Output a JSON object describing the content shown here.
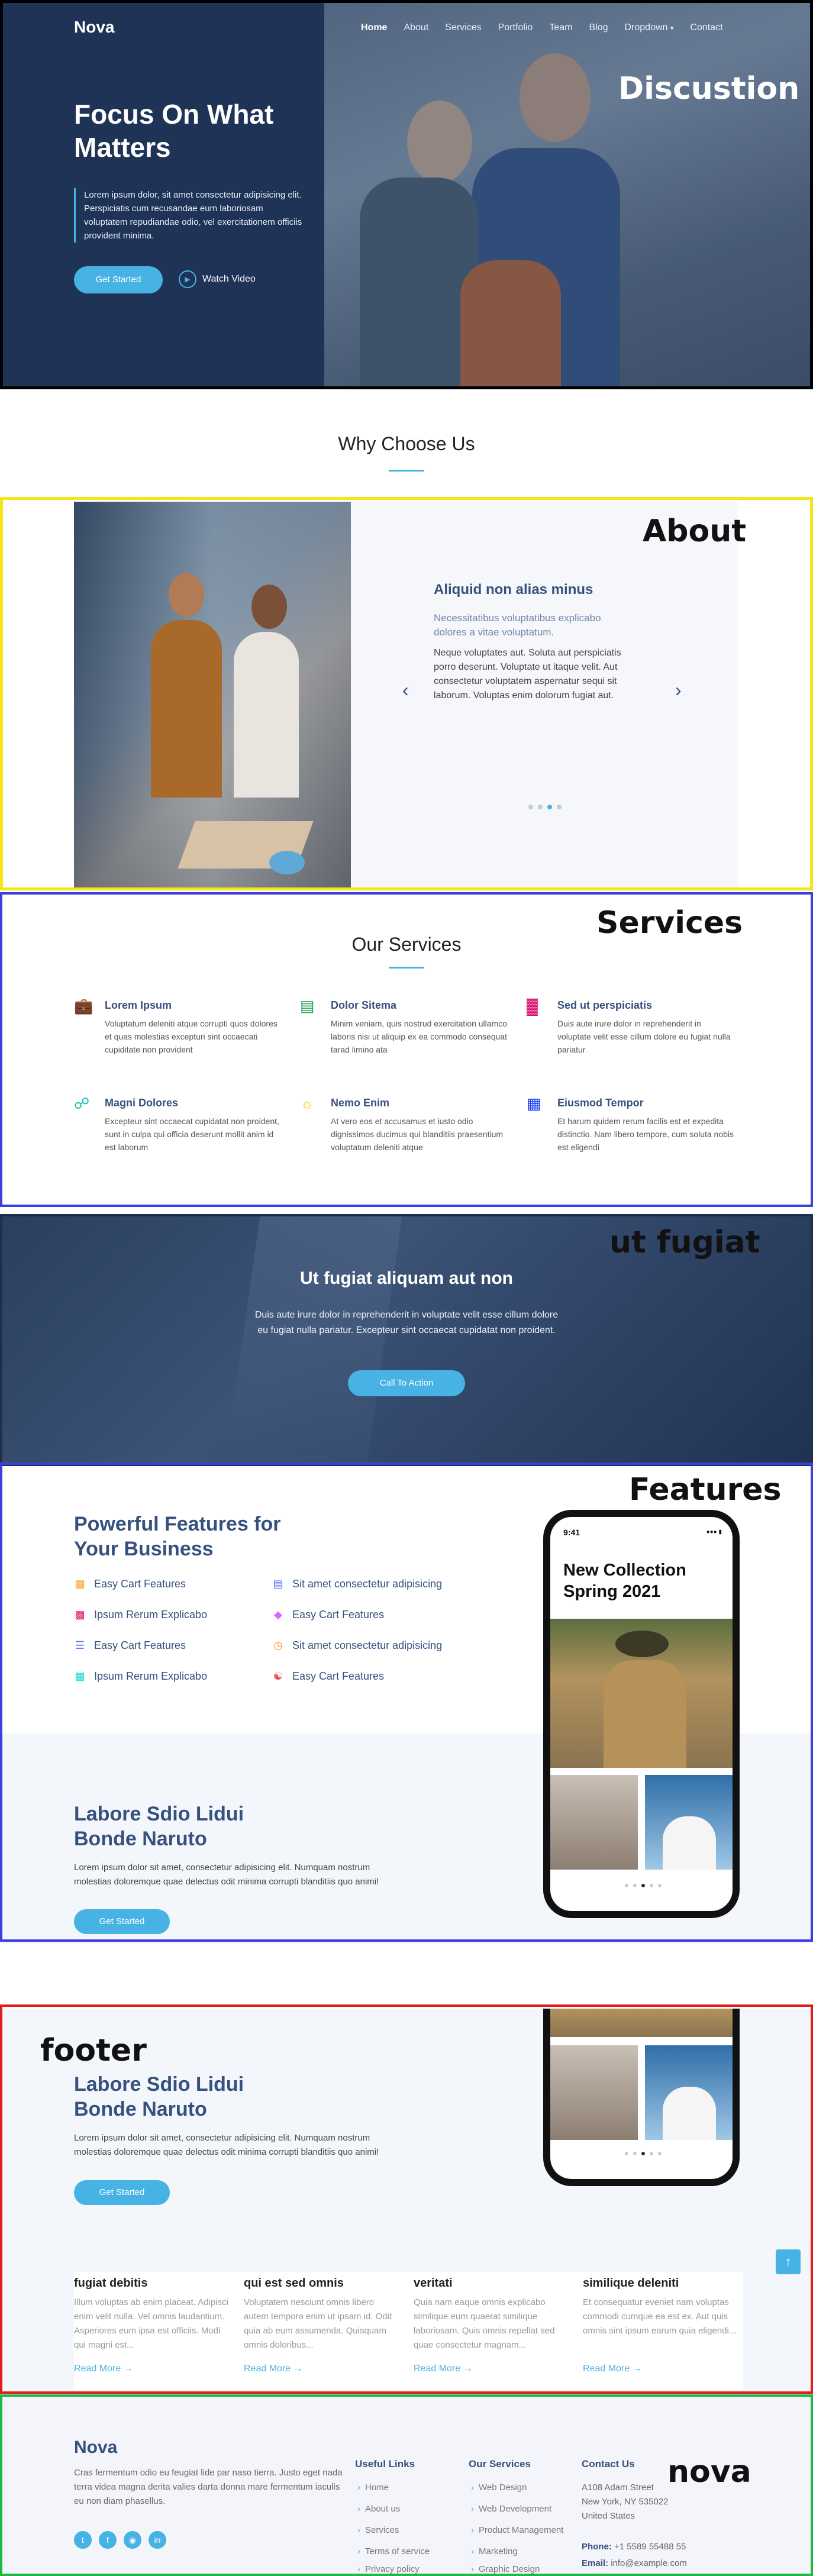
{
  "colors": {
    "accent": "#47b2e4",
    "navy": "#37517e",
    "hero_bg": "#1e3356"
  },
  "nav": {
    "logo": "Nova",
    "items": [
      "Home",
      "About",
      "Services",
      "Portfolio",
      "Team",
      "Blog",
      "Dropdown",
      "Contact"
    ]
  },
  "hero": {
    "title": "Focus On What Matters",
    "lead": "Lorem ipsum dolor, sit amet consectetur adipisicing elit. Perspiciatis cum recusandae eum laboriosam voluptatem repudiandae odio, vel exercitationem officiis provident minima.",
    "get_started": "Get Started",
    "watch_video": "Watch Video",
    "annotation": "Discustion"
  },
  "why": {
    "title": "Why Choose Us"
  },
  "about": {
    "annotation": "About",
    "heading": "Aliquid non alias minus",
    "subheading": "Necessitatibus voluptatibus explicabo dolores a vitae voluptatum.",
    "text": "Neque voluptates aut. Soluta aut perspiciatis porro deserunt. Voluptate ut itaque velit. Aut consectetur voluptatem aspernatur sequi sit laborum. Voluptas enim dolorum fugiat aut."
  },
  "services": {
    "annotation": "Services",
    "title": "Our Services",
    "items": [
      {
        "icon": "briefcase-icon",
        "title": "Lorem Ipsum",
        "text": "Voluptatum deleniti atque corrupti quos dolores et quas molestias excepturi sint occaecati cupiditate non provident"
      },
      {
        "icon": "card-checklist-icon",
        "title": "Dolor Sitema",
        "text": "Minim veniam, quis nostrud exercitation ullamco laboris nisi ut aliquip ex ea commodo consequat tarad limino ata"
      },
      {
        "icon": "bar-chart-icon",
        "title": "Sed ut perspiciatis",
        "text": "Duis aute irure dolor in reprehenderit in voluptate velit esse cillum dolore eu fugiat nulla pariatur"
      },
      {
        "icon": "binoculars-icon",
        "title": "Magni Dolores",
        "text": "Excepteur sint occaecat cupidatat non proident, sunt in culpa qui officia deserunt mollit anim id est laborum"
      },
      {
        "icon": "brightness-icon",
        "title": "Nemo Enim",
        "text": "At vero eos et accusamus et iusto odio dignissimos ducimus qui blanditiis praesentium voluptatum deleniti atque"
      },
      {
        "icon": "calendar-icon",
        "title": "Eiusmod Tempor",
        "text": "Et harum quidem rerum facilis est et expedita distinctio. Nam libero tempore, cum soluta nobis est eligendi"
      }
    ]
  },
  "cta": {
    "annotation": "ut fugiat",
    "title": "Ut fugiat aliquam aut non",
    "text": "Duis aute irure dolor in reprehenderit in voluptate velit esse cillum dolore eu fugiat nulla pariatur. Excepteur sint occaecat cupidatat non proident.",
    "button": "Call To Action"
  },
  "features": {
    "annotation": "Features",
    "title": "Powerful Features for Your Business",
    "items": [
      {
        "icon": "bag-icon",
        "label": "Easy Cart Features",
        "color": "#f5a623"
      },
      {
        "icon": "card-icon",
        "label": "Sit amet consectetur adipisicing",
        "color": "#5578ff"
      },
      {
        "icon": "tags-icon",
        "label": "Ipsum Rerum Explicabo",
        "color": "#e80368"
      },
      {
        "icon": "tags-icon",
        "label": "Easy Cart Features",
        "color": "#e361ff"
      },
      {
        "icon": "stack-icon",
        "label": "Easy Cart Features",
        "color": "#5578ff"
      },
      {
        "icon": "clock-icon",
        "label": "Sit amet consectetur adipisicing",
        "color": "#f58b1e"
      },
      {
        "icon": "list-icon",
        "label": "Ipsum Rerum Explicabo",
        "color": "#11dbcf"
      },
      {
        "icon": "people-icon",
        "label": "Easy Cart Features",
        "color": "#e84d4d"
      }
    ],
    "block_title": "Labore Sdio Lidui Bonde Naruto",
    "block_text": "Lorem ipsum dolor sit amet, consectetur adipisicing elit. Numquam nostrum molestias doloremque quae delectus odit minima corrupti blanditiis quo animi!",
    "block_button": "Get Started",
    "phone_time": "9:41",
    "phone_title": "New Collection Spring 2021"
  },
  "footer_section": {
    "annotation": "footer",
    "block_title": "Labore Sdio Lidui Bonde Naruto",
    "block_text": "Lorem ipsum dolor sit amet, consectetur adipisicing elit. Numquam nostrum molestias doloremque quae delectus odit minima corrupti blanditiis quo animi!",
    "block_button": "Get Started",
    "cards": [
      {
        "title": "fugiat debitis",
        "text": "Illum voluptas ab enim placeat. Adipisci enim velit nulla. Vel omnis laudantium. Asperiores eum ipsa est officiis. Modi qui magni est...",
        "link": "Read More"
      },
      {
        "title": "qui est sed omnis",
        "text": "Voluptatem nesciunt omnis libero autem tempora enim ut ipsam id. Odit quia ab eum assumenda. Quisquam omnis doloribus...",
        "link": "Read More"
      },
      {
        "title": "veritati",
        "text": "Quia nam eaque omnis explicabo similique eum quaerat similique laboriosam. Quis omnis repellat sed quae consectetur magnam...",
        "link": "Read More"
      },
      {
        "title": "similique deleniti",
        "text": "Et consequatur eveniet nam voluptas commodi cumque ea est ex. Aut quis omnis sint ipsum earum quia eligendi...",
        "link": "Read More"
      }
    ]
  },
  "footer": {
    "annotation": "nova",
    "logo": "Nova",
    "about": "Cras fermentum odio eu feugiat lide par naso tierra. Justo eget nada terra videa magna derita valies darta donna mare fermentum iaculis eu non diam phasellus.",
    "useful_links_title": "Useful Links",
    "useful_links": [
      "Home",
      "About us",
      "Services",
      "Terms of service",
      "Privacy policy"
    ],
    "services_title": "Our Services",
    "services_links": [
      "Web Design",
      "Web Development",
      "Product Management",
      "Marketing",
      "Graphic Design"
    ],
    "contact_title": "Contact Us",
    "address1": "A108 Adam Street",
    "address2": "New York, NY 535022",
    "country": "United States",
    "phone_label": "Phone:",
    "phone": "+1 5589 55488 55",
    "email_label": "Email:",
    "email": "info@example.com"
  }
}
